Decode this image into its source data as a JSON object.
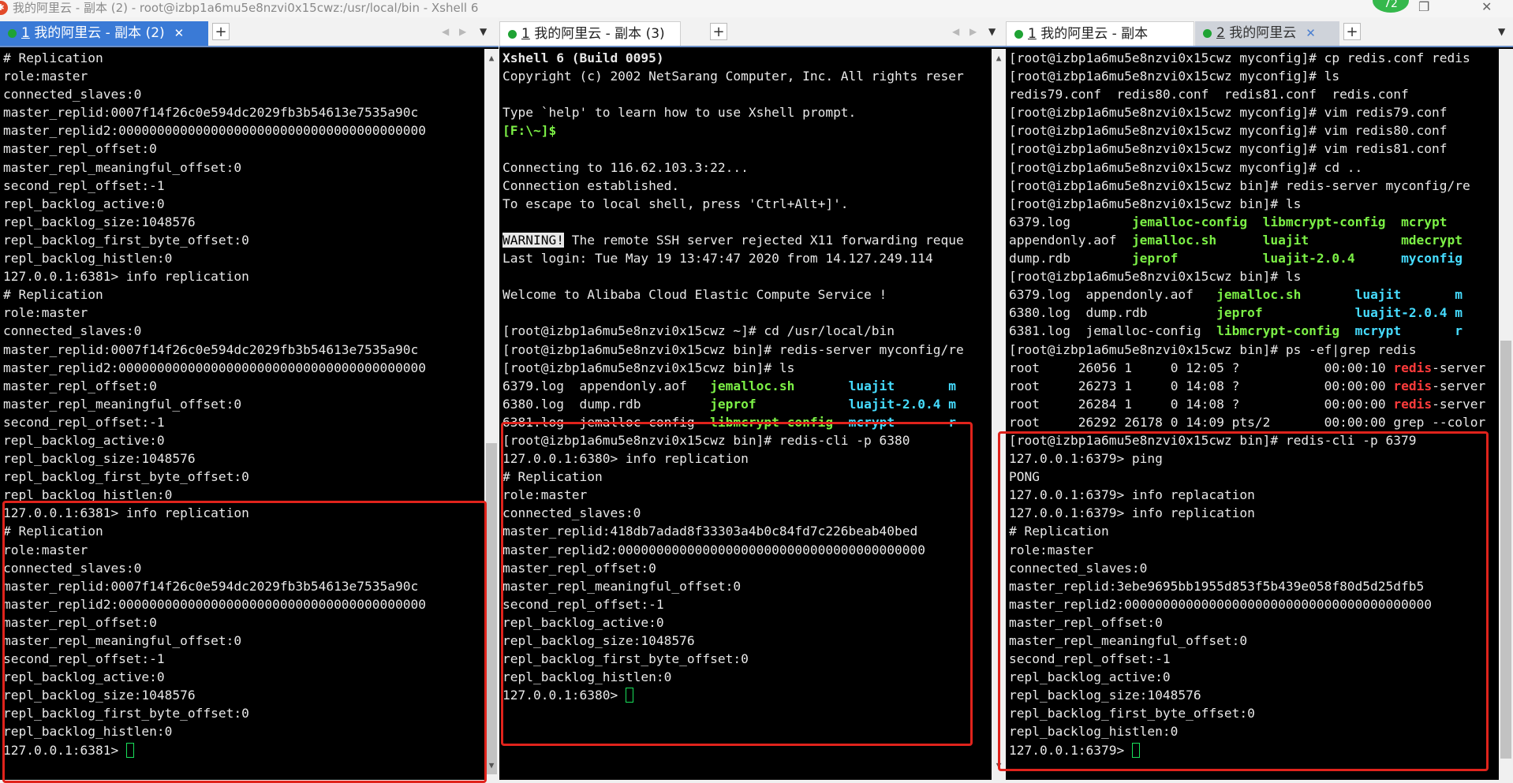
{
  "window": {
    "title": "我的阿里云 - 副本 (2) - root@izbp1a6mu5e8nzvi0x15cwz:/usr/local/bin - Xshell 6",
    "notification_count": "72"
  },
  "pane1": {
    "tabs": [
      {
        "num": "1",
        "label": "我的阿里云 - 副本 (2)"
      }
    ],
    "lines": [
      "# Replication",
      "role:master",
      "connected_slaves:0",
      "master_replid:0007f14f26c0e594dc2029fb3b54613e7535a90c",
      "master_replid2:0000000000000000000000000000000000000000",
      "master_repl_offset:0",
      "master_repl_meaningful_offset:0",
      "second_repl_offset:-1",
      "repl_backlog_active:0",
      "repl_backlog_size:1048576",
      "repl_backlog_first_byte_offset:0",
      "repl_backlog_histlen:0",
      "127.0.0.1:6381> info replication",
      "# Replication",
      "role:master",
      "connected_slaves:0",
      "master_replid:0007f14f26c0e594dc2029fb3b54613e7535a90c",
      "master_replid2:0000000000000000000000000000000000000000",
      "master_repl_offset:0",
      "master_repl_meaningful_offset:0",
      "second_repl_offset:-1",
      "repl_backlog_active:0",
      "repl_backlog_size:1048576",
      "repl_backlog_first_byte_offset:0",
      "repl_backlog_histlen:0",
      "127.0.0.1:6381> info replication",
      "# Replication",
      "role:master",
      "connected_slaves:0",
      "master_replid:0007f14f26c0e594dc2029fb3b54613e7535a90c",
      "master_replid2:0000000000000000000000000000000000000000",
      "master_repl_offset:0",
      "master_repl_meaningful_offset:0",
      "second_repl_offset:-1",
      "repl_backlog_active:0",
      "repl_backlog_size:1048576",
      "repl_backlog_first_byte_offset:0",
      "repl_backlog_histlen:0"
    ],
    "prompt": "127.0.0.1:6381> "
  },
  "pane2": {
    "tabs": [
      {
        "num": "1",
        "label": "我的阿里云 - 副本 (3)"
      }
    ],
    "lines": [
      "Xshell 6 (Build 0095)",
      "Copyright (c) 2002 NetSarang Computer, Inc. All rights reser",
      "",
      "Type `help' to learn how to use Xshell prompt.",
      "[F:\\~]$",
      "",
      "Connecting to 116.62.103.3:22...",
      "Connection established.",
      "To escape to local shell, press 'Ctrl+Alt+]'.",
      "",
      "The remote SSH server rejected X11 forwarding reque",
      "Last login: Tue May 19 13:47:47 2020 from 14.127.249.114",
      "",
      "Welcome to Alibaba Cloud Elastic Compute Service !",
      "",
      "[root@izbp1a6mu5e8nzvi0x15cwz ~]# cd /usr/local/bin",
      "[root@izbp1a6mu5e8nzvi0x15cwz bin]# redis-server myconfig/re",
      "[root@izbp1a6mu5e8nzvi0x15cwz bin]# ls",
      "",
      "",
      "",
      "[root@izbp1a6mu5e8nzvi0x15cwz bin]# redis-cli -p 6380",
      "127.0.0.1:6380> info replication",
      "# Replication",
      "role:master",
      "connected_slaves:0",
      "master_replid:418db7adad8f33303a4b0c84fd7c226beab40bed",
      "master_replid2:0000000000000000000000000000000000000000",
      "master_repl_offset:0",
      "master_repl_meaningful_offset:0",
      "second_repl_offset:-1",
      "repl_backlog_active:0",
      "repl_backlog_size:1048576",
      "repl_backlog_first_byte_offset:0",
      "repl_backlog_histlen:0"
    ],
    "warning_label": "WARNING!",
    "ls_rows": [
      [
        "6379.log",
        "appendonly.aof",
        "jemalloc.sh",
        "luajit",
        "m"
      ],
      [
        "6380.log",
        "dump.rdb",
        "jeprof",
        "luajit-2.0.4",
        "m"
      ],
      [
        "6381.log",
        "jemalloc-config",
        "libmcrypt-config",
        "mcrypt",
        "r"
      ]
    ],
    "prompt": "127.0.0.1:6380> "
  },
  "pane3": {
    "tabs": [
      {
        "num": "1",
        "label": "我的阿里云 - 副本"
      },
      {
        "num": "2",
        "label": "我的阿里云"
      }
    ],
    "lines": [
      "[root@izbp1a6mu5e8nzvi0x15cwz myconfig]# cp redis.conf redis",
      "[root@izbp1a6mu5e8nzvi0x15cwz myconfig]# ls",
      "redis79.conf  redis80.conf  redis81.conf  redis.conf",
      "[root@izbp1a6mu5e8nzvi0x15cwz myconfig]# vim redis79.conf",
      "[root@izbp1a6mu5e8nzvi0x15cwz myconfig]# vim redis80.conf",
      "[root@izbp1a6mu5e8nzvi0x15cwz myconfig]# vim redis81.conf",
      "[root@izbp1a6mu5e8nzvi0x15cwz myconfig]# cd ..",
      "[root@izbp1a6mu5e8nzvi0x15cwz bin]# redis-server myconfig/re",
      "[root@izbp1a6mu5e8nzvi0x15cwz bin]# ls",
      "",
      "",
      "",
      "[root@izbp1a6mu5e8nzvi0x15cwz bin]# ls",
      "",
      "",
      "",
      "[root@izbp1a6mu5e8nzvi0x15cwz bin]# ps -ef|grep redis",
      "",
      "",
      "",
      "",
      "[root@izbp1a6mu5e8nzvi0x15cwz bin]# redis-cli -p 6379",
      "127.0.0.1:6379> ping",
      "PONG",
      "127.0.0.1:6379> info replacation",
      "127.0.0.1:6379> info replication",
      "# Replication",
      "role:master",
      "connected_slaves:0",
      "master_replid:3ebe9695bb1955d853f5b439e058f80d5d25dfb5",
      "master_replid2:0000000000000000000000000000000000000000",
      "master_repl_offset:0",
      "master_repl_meaningful_offset:0",
      "second_repl_offset:-1",
      "repl_backlog_active:0",
      "repl_backlog_size:1048576",
      "repl_backlog_first_byte_offset:0",
      "repl_backlog_histlen:0"
    ],
    "ls_wide_rows": [
      [
        "6379.log",
        "jemalloc-config",
        "libmcrypt-config",
        "mcrypt"
      ],
      [
        "appendonly.aof",
        "jemalloc.sh",
        "luajit",
        "mdecrypt"
      ],
      [
        "dump.rdb",
        "jeprof",
        "luajit-2.0.4",
        "myconfig"
      ]
    ],
    "ls_rows": [
      [
        "6379.log",
        "appendonly.aof",
        "jemalloc.sh",
        "luajit",
        "m"
      ],
      [
        "6380.log",
        "dump.rdb",
        "jeprof",
        "luajit-2.0.4",
        "m"
      ],
      [
        "6381.log",
        "jemalloc-config",
        "libmcrypt-config",
        "mcrypt",
        "r"
      ]
    ],
    "ps_rows": [
      {
        "user": "root",
        "pid": "26056",
        "ppid": "1",
        "c": "0",
        "stime": "12:05",
        "tty": "?",
        "time": "00:00:10",
        "cmd": "redis",
        "cmd_rest": "-server"
      },
      {
        "user": "root",
        "pid": "26273",
        "ppid": "1",
        "c": "0",
        "stime": "14:08",
        "tty": "?",
        "time": "00:00:00",
        "cmd": "redis",
        "cmd_rest": "-server"
      },
      {
        "user": "root",
        "pid": "26284",
        "ppid": "1",
        "c": "0",
        "stime": "14:08",
        "tty": "?",
        "time": "00:00:00",
        "cmd": "redis",
        "cmd_rest": "-server"
      },
      {
        "user": "root",
        "pid": "26292",
        "ppid": "26178",
        "c": "0",
        "stime": "14:09",
        "tty": "pts/2",
        "time": "00:00:00",
        "cmd": "grep --color",
        "cmd_rest": ""
      }
    ],
    "prompt": "127.0.0.1:6379> "
  },
  "colors": {
    "terminal_bg": "#000000",
    "terminal_fg": "#e8e8e8",
    "green": "#7cf046",
    "cyan": "#46dcff",
    "red": "#ff3b3b",
    "highlight_box": "#e0231c",
    "active_tab": "#3a7ad6"
  }
}
